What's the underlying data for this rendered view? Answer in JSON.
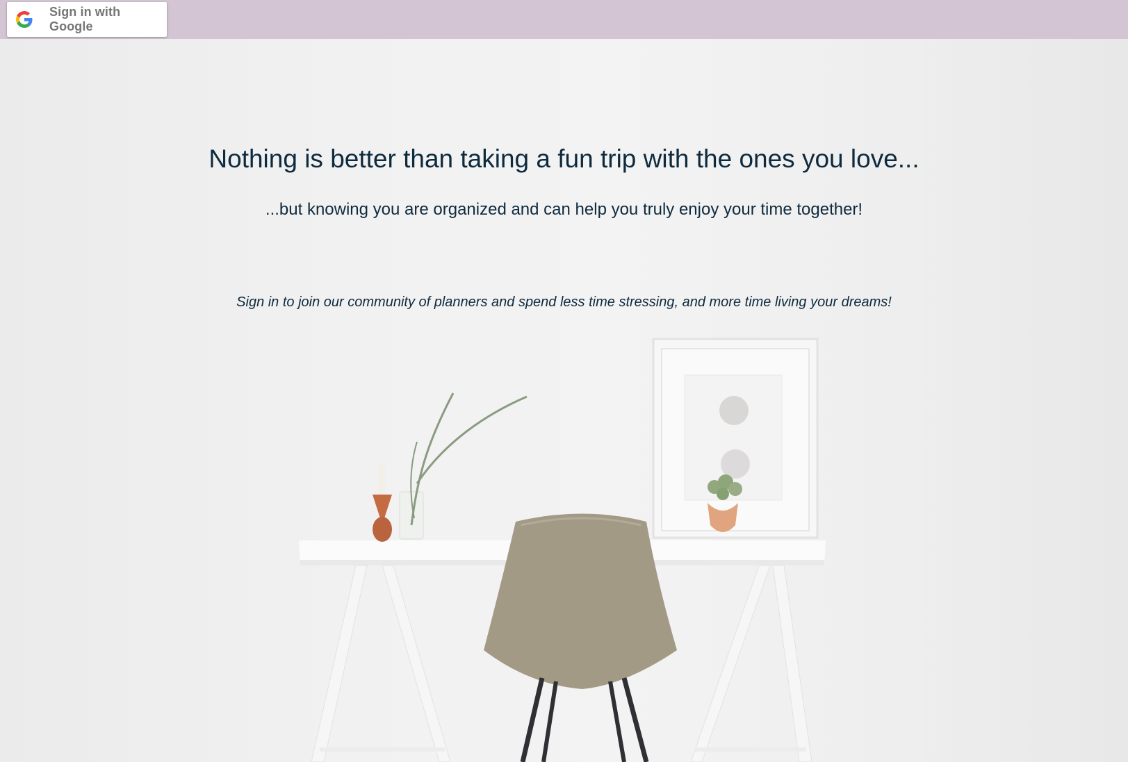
{
  "topbar": {
    "signin_label": "Sign in with Google",
    "background": "#d3c5d4"
  },
  "hero": {
    "headline": "Nothing is better than taking a fun trip with the ones you love...",
    "subline": "...but knowing you are organized and can help you truly enjoy your time together!",
    "tagline": "Sign in to join our community of planners and spend less time stressing, and more time living your dreams!",
    "text_color": "#0e2a3e"
  },
  "icons": {
    "signin": "google-g-icon"
  }
}
